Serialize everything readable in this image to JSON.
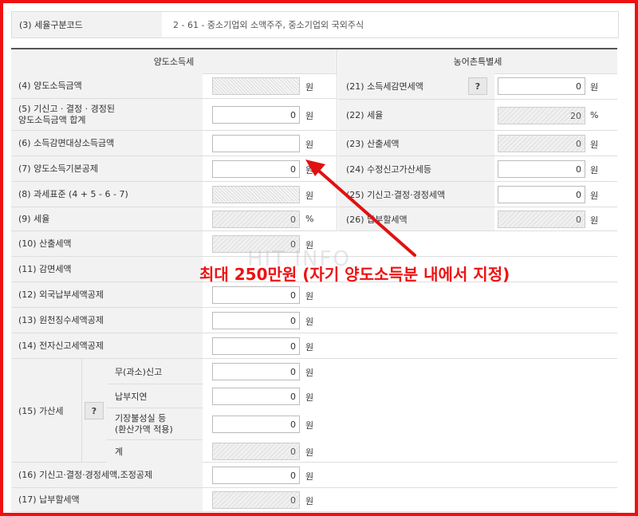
{
  "top": {
    "label": "(3) 세율구분코드",
    "value": "2  -  61  -  중소기업외 소액주주, 중소기업외 국외주식"
  },
  "headers": {
    "left": "양도소득세",
    "right": "농어촌특별세"
  },
  "units": {
    "won": "원",
    "percent": "%"
  },
  "left_rows": [
    {
      "label": "(4) 양도소득금액",
      "value": "",
      "unit": "원"
    },
    {
      "label": "(5) 기신고 · 결정 · 경정된\n양도소득금액 합계",
      "value": "0",
      "unit": "원"
    },
    {
      "label": "(6) 소득감면대상소득금액",
      "value": "",
      "unit": "원"
    },
    {
      "label": "(7) 양도소득기본공제",
      "value": "0",
      "unit": "원"
    },
    {
      "label": "(8) 과세표준 (4 + 5 - 6 - 7)",
      "value": "",
      "unit": "원"
    },
    {
      "label": "(9) 세율",
      "value": "0",
      "unit": "%"
    },
    {
      "label": "(10) 산출세액",
      "value": "0",
      "unit": "원"
    },
    {
      "label": "(11) 감면세액",
      "value": "",
      "unit": "원"
    },
    {
      "label": "(12) 외국납부세액공제",
      "value": "0",
      "unit": "원"
    },
    {
      "label": "(13) 원천징수세액공제",
      "value": "0",
      "unit": "원"
    },
    {
      "label": "(14) 전자신고세액공제",
      "value": "0",
      "unit": "원"
    }
  ],
  "penalty": {
    "label": "(15) 가산세",
    "help": "?",
    "items": [
      {
        "label": "무(과소)신고",
        "value": "0",
        "unit": "원"
      },
      {
        "label": "납부지연",
        "value": "0",
        "unit": "원"
      },
      {
        "label": "기장불성실 등\n(환산가액 적용)",
        "value": "0",
        "unit": "원"
      },
      {
        "label": "계",
        "value": "0",
        "unit": "원"
      }
    ]
  },
  "bottom_rows": [
    {
      "label": "(16) 기신고·결정·경정세액,조정공제",
      "value": "0",
      "unit": "원"
    },
    {
      "label": "(17) 납부할세액",
      "value": "0",
      "unit": "원"
    }
  ],
  "right_rows": [
    {
      "label": "(21) 소득세감면세액",
      "help": "?",
      "value": "0",
      "unit": "원"
    },
    {
      "label": "(22) 세율",
      "value": "20",
      "unit": "%"
    },
    {
      "label": "(23) 산출세액",
      "value": "0",
      "unit": "원"
    },
    {
      "label": "(24) 수정신고가산세등",
      "value": "0",
      "unit": "원"
    },
    {
      "label": "(25) 기신고·결정·경정세액",
      "value": "0",
      "unit": "원"
    },
    {
      "label": "(26) 납부할세액",
      "value": "0",
      "unit": "원"
    }
  ],
  "annotation": "최대 250만원 (자기 양도소득분 내에서 지정)",
  "watermark": "HIT INFO",
  "colors": {
    "annotation": "#e11111",
    "frame": "#e11111",
    "label_bg": "#f2f2f2"
  }
}
